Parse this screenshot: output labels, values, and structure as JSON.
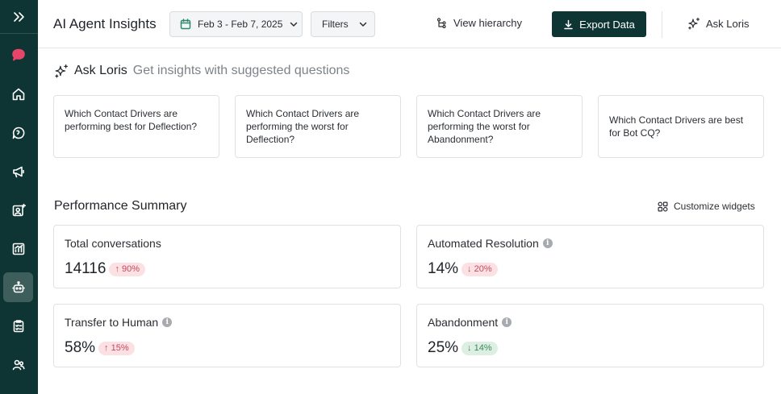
{
  "header": {
    "title": "AI Agent Insights",
    "date_range": "Feb 3 - Feb 7, 2025",
    "filters_label": "Filters",
    "view_hierarchy_label": "View hierarchy",
    "export_label": "Export Data",
    "ask_label": "Ask Loris"
  },
  "ask_loris": {
    "title": "Ask Loris",
    "subtitle": "Get insights with suggested questions",
    "questions": [
      "Which Contact Drivers are performing best for Deflection?",
      "Which Contact Drivers are performing the worst for Deflection?",
      "Which Contact Drivers are performing the worst for Abandonment?",
      "Which Contact Drivers are best for Bot CQ?"
    ]
  },
  "performance": {
    "title": "Performance Summary",
    "customize_label": "Customize widgets",
    "metrics": [
      {
        "label": "Total conversations",
        "value": "14116",
        "change": "↑ 90%",
        "trend": "red",
        "info": false
      },
      {
        "label": "Automated Resolution",
        "value": "14%",
        "change": "↓ 20%",
        "trend": "red",
        "info": true
      },
      {
        "label": "Transfer to Human",
        "value": "58%",
        "change": "↑ 15%",
        "trend": "red",
        "info": true
      },
      {
        "label": "Abandonment",
        "value": "25%",
        "change": "↓ 14%",
        "trend": "green",
        "info": true
      }
    ]
  },
  "sidebar": {
    "icons": [
      "expand-icon",
      "chat-bubble-icon",
      "home-icon",
      "conversation-icon",
      "megaphone-icon",
      "profile-spark-icon",
      "analytics-icon",
      "bot-icon",
      "checklist-icon",
      "users-icon"
    ],
    "active": "bot-icon"
  },
  "colors": {
    "sidebar_bg": "#0e3533",
    "accent_red": "#e8456b",
    "badge_red_bg": "#fbe0e4",
    "badge_green_bg": "#dcefe2"
  }
}
